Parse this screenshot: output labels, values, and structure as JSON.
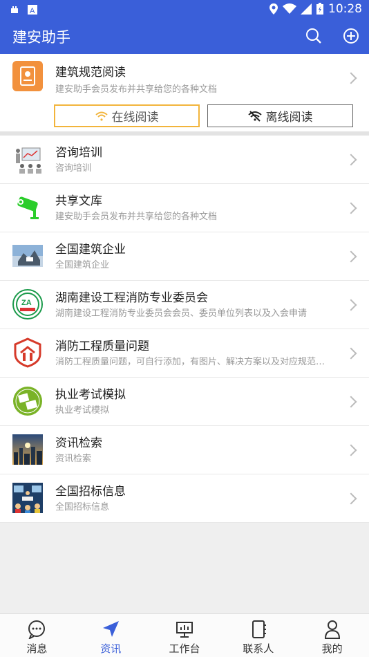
{
  "status_bar": {
    "time": "10:28"
  },
  "app_bar": {
    "title": "建安助手"
  },
  "top_card": {
    "title": "建筑规范阅读",
    "subtitle": "建安助手会员发布并共享给您的各种文档",
    "online_label": "在线阅读",
    "offline_label": "离线阅读"
  },
  "list": [
    {
      "title": "咨询培训",
      "subtitle": "咨询培训"
    },
    {
      "title": "共享文库",
      "subtitle": "建安助手会员发布并共享给您的各种文档"
    },
    {
      "title": "全国建筑企业",
      "subtitle": "全国建筑企业"
    },
    {
      "title": "湖南建设工程消防专业委员会",
      "subtitle": "湖南建设工程消防专业委员会会员、委员单位列表以及入会申请"
    },
    {
      "title": "消防工程质量问题",
      "subtitle": "消防工程质量问题，可自行添加，有图片、解决方案以及对应规范…"
    },
    {
      "title": "执业考试模拟",
      "subtitle": "执业考试模拟"
    },
    {
      "title": "资讯检索",
      "subtitle": "资讯检索"
    },
    {
      "title": "全国招标信息",
      "subtitle": "全国招标信息"
    }
  ],
  "bottom_nav": {
    "messages": "消息",
    "news": "资讯",
    "workbench": "工作台",
    "contacts": "联系人",
    "mine": "我的"
  },
  "colors": {
    "primary": "#3a5fd9",
    "accent_orange": "#f2913d",
    "online_border": "#f2b43b"
  }
}
